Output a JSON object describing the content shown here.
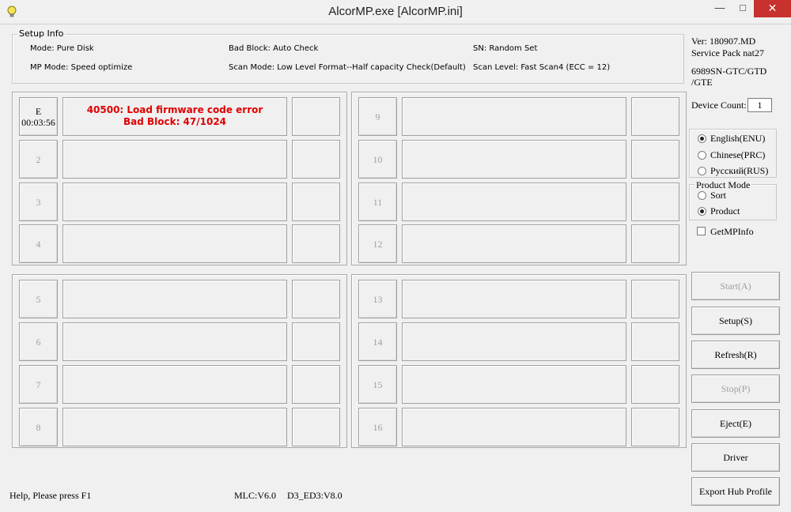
{
  "window": {
    "title": "AlcorMP.exe [AlcorMP.ini]",
    "app_icon": "lightbulb-icon",
    "minimize_glyph": "—",
    "maximize_glyph": "□",
    "close_glyph": "✕"
  },
  "setup_info": {
    "legend": "Setup Info",
    "mode": "Mode: Pure Disk",
    "bad_block": "Bad Block: Auto Check",
    "sn": "SN: Random Set",
    "mp_mode": "MP Mode: Speed optimize",
    "scan_mode": "Scan Mode: Low Level Format--Half capacity Check(Default)",
    "scan_level": "Scan Level: Fast Scan4 (ECC = 12)"
  },
  "version": {
    "ver": "Ver: 180907.MD",
    "service_pack": "Service Pack nat27",
    "chip_line1": "6989SN-GTC/GTD",
    "chip_line2": "/GTE"
  },
  "device_count": {
    "label": "Device Count:",
    "value": "1"
  },
  "language": {
    "options": [
      "English(ENU)",
      "Chinese(PRC)",
      "Русский(RUS)"
    ],
    "selected": "English(ENU)"
  },
  "product_mode": {
    "legend": "Product Mode",
    "options": [
      "Sort",
      "Product"
    ],
    "selected": "Product"
  },
  "getmpinfo": {
    "label": "GetMPInfo",
    "checked": false
  },
  "ports": [
    {
      "label": "E",
      "time": "00:03:56",
      "active": true,
      "message_line1": "40500: Load firmware code error",
      "message_line2": "Bad Block: 47/1024"
    },
    {
      "label": "2"
    },
    {
      "label": "3"
    },
    {
      "label": "4"
    },
    {
      "label": "5"
    },
    {
      "label": "6"
    },
    {
      "label": "7"
    },
    {
      "label": "8"
    },
    {
      "label": "9"
    },
    {
      "label": "10"
    },
    {
      "label": "11"
    },
    {
      "label": "12"
    },
    {
      "label": "13"
    },
    {
      "label": "14"
    },
    {
      "label": "15"
    },
    {
      "label": "16"
    }
  ],
  "buttons": {
    "start": "Start(A)",
    "setup": "Setup(S)",
    "refresh": "Refresh(R)",
    "stop": "Stop(P)",
    "eject": "Eject(E)",
    "driver": "Driver",
    "export": "Export Hub Profile"
  },
  "status_bar": {
    "help": "Help, Please press F1",
    "mlc": "MLC:V6.0",
    "d3": "D3_ED3:V8.0"
  },
  "colors": {
    "error_text": "#e00000",
    "close_button": "#c7312e",
    "window_bg": "#f0f0f0"
  }
}
